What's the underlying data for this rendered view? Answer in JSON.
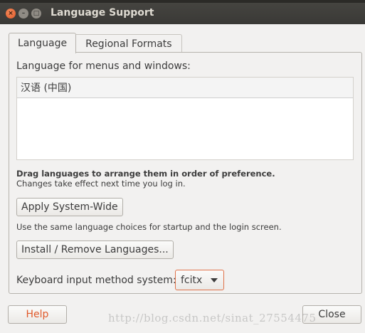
{
  "window": {
    "title": "Language Support",
    "close_glyph": "×",
    "min_glyph": "–",
    "max_glyph": "□"
  },
  "tabs": [
    {
      "label": "Language",
      "active": true
    },
    {
      "label": "Regional Formats",
      "active": false
    }
  ],
  "language_tab": {
    "list_label": "Language for menus and windows:",
    "languages": [
      "汉语 (中国)"
    ],
    "drag_hint": "Drag languages to arrange them in order of preference.",
    "effect_hint": "Changes take effect next time you log in.",
    "apply_button": "Apply System-Wide",
    "apply_desc": "Use the same language choices for startup and the login screen.",
    "install_button": "Install / Remove Languages...",
    "keyboard_label": "Keyboard input method system:",
    "keyboard_value": "fcitx"
  },
  "footer": {
    "help_button": "Help",
    "close_button": "Close"
  },
  "watermark": "http://blog.csdn.net/sinat_27554475",
  "colors": {
    "accent": "#e0592a",
    "titlebar": "#3a3936",
    "background": "#f2f1f0"
  }
}
